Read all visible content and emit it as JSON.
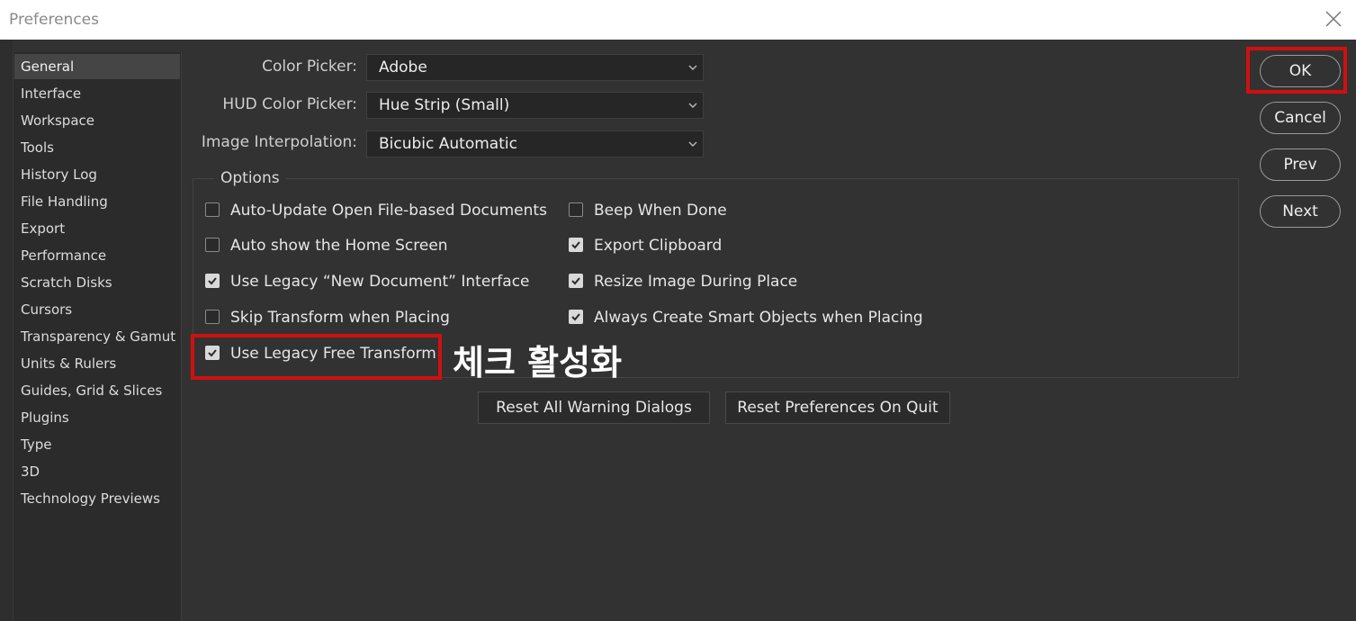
{
  "window": {
    "title": "Preferences"
  },
  "sidebar": {
    "items": [
      {
        "label": "General",
        "selected": true
      },
      {
        "label": "Interface"
      },
      {
        "label": "Workspace"
      },
      {
        "label": "Tools"
      },
      {
        "label": "History Log"
      },
      {
        "label": "File Handling"
      },
      {
        "label": "Export"
      },
      {
        "label": "Performance"
      },
      {
        "label": "Scratch Disks"
      },
      {
        "label": "Cursors"
      },
      {
        "label": "Transparency & Gamut"
      },
      {
        "label": "Units & Rulers"
      },
      {
        "label": "Guides, Grid & Slices"
      },
      {
        "label": "Plugins"
      },
      {
        "label": "Type"
      },
      {
        "label": "3D"
      },
      {
        "label": "Technology Previews"
      }
    ]
  },
  "fields": {
    "color_picker": {
      "label": "Color Picker:",
      "value": "Adobe"
    },
    "hud_color_picker": {
      "label": "HUD Color Picker:",
      "value": "Hue Strip (Small)"
    },
    "image_interpolation": {
      "label": "Image Interpolation:",
      "value": "Bicubic Automatic"
    }
  },
  "options": {
    "legend": "Options",
    "left": [
      {
        "label": "Auto-Update Open File-based Documents",
        "checked": false
      },
      {
        "label": "Auto show the Home Screen",
        "checked": false
      },
      {
        "label": "Use Legacy “New Document” Interface",
        "checked": true
      },
      {
        "label": "Skip Transform when Placing",
        "checked": false
      },
      {
        "label": "Use Legacy Free Transform",
        "checked": true
      }
    ],
    "right": [
      {
        "label": "Beep When Done",
        "checked": false
      },
      {
        "label": "Export Clipboard",
        "checked": true
      },
      {
        "label": "Resize Image During Place",
        "checked": true
      },
      {
        "label": "Always Create Smart Objects when Placing",
        "checked": true
      }
    ]
  },
  "annotation": {
    "text": "체크 활성화",
    "color": "#ffffff",
    "highlight_color": "#d01010"
  },
  "buttons": {
    "reset_warnings": "Reset All Warning Dialogs",
    "reset_prefs": "Reset Preferences On Quit",
    "ok": "OK",
    "cancel": "Cancel",
    "prev": "Prev",
    "next": "Next"
  }
}
